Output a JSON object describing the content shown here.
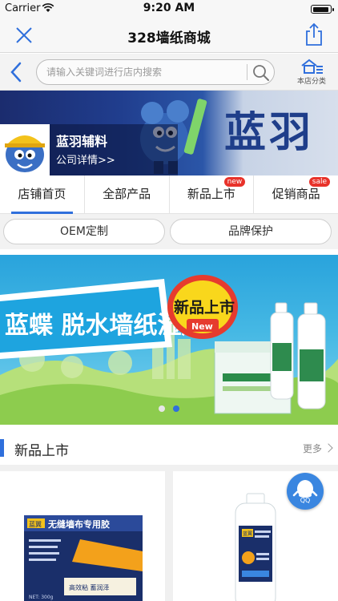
{
  "status_bar": {
    "carrier": "Carrier",
    "time": "9:20 AM"
  },
  "nav": {
    "title": "328墙纸商城"
  },
  "search": {
    "placeholder": "请输入关键词进行店内搜索",
    "category_label": "本店分类"
  },
  "store": {
    "banner_text": "蓝羽",
    "name": "蓝羽辅料",
    "detail_link": "公司详情>>"
  },
  "tabs": [
    {
      "label": "店铺首页",
      "badge": ""
    },
    {
      "label": "全部产品",
      "badge": ""
    },
    {
      "label": "新品上市",
      "badge": "new"
    },
    {
      "label": "促销商品",
      "badge": "sale"
    }
  ],
  "subtabs": [
    {
      "label": "OEM定制"
    },
    {
      "label": "品牌保护"
    }
  ],
  "promo": {
    "headline": "蓝蝶 脱水墙纸湿胶",
    "stamp": "新品上市",
    "stamp_en": "New",
    "slide_index": 1,
    "slide_count": 2
  },
  "section": {
    "title": "新品上市",
    "more": "更多"
  },
  "products": [
    {
      "box_title": "无缝墙布专用胶",
      "box_brand": "蓝翼",
      "box_slogan": "高效粘   蓄润泽",
      "box_net": "NET: 300g"
    },
    {
      "box_brand": "蓝翼"
    }
  ],
  "qq": {
    "label": "QQ"
  },
  "colors": {
    "accent": "#2f6fdc",
    "badge": "#e8322a",
    "promo_bg": "#29a3dc"
  }
}
